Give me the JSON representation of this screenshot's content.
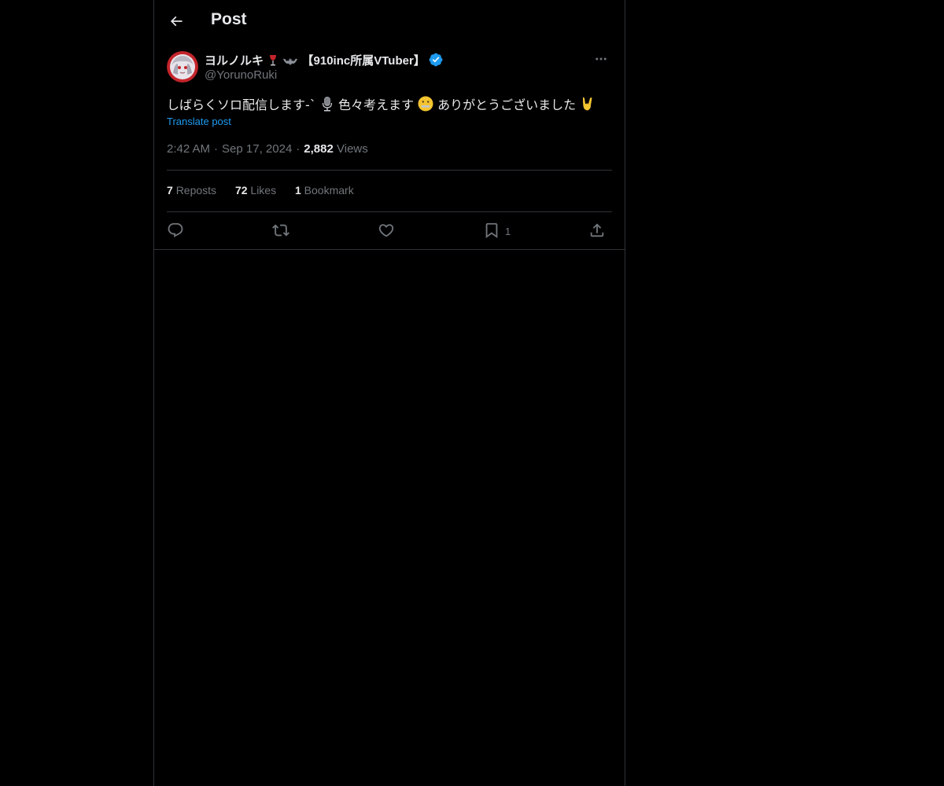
{
  "header": {
    "back_icon": "arrow-left-icon",
    "title": "Post"
  },
  "author": {
    "name": "ヨルノルキ",
    "name_suffix": "【910inc所属VTuber】",
    "name_emojis": [
      "wine-glass-icon",
      "bat-icon"
    ],
    "verified": true,
    "verified_color": "#1d9bf0",
    "handle": "@YorunoRuki",
    "more_icon": "more-horizontal-icon"
  },
  "post": {
    "text_part1": "しばらくソロ配信します-`",
    "text_part2": "色々考えます",
    "text_part3": "ありがとうございました",
    "inline_emojis": [
      "microphone-icon",
      "zipper-mouth-face-icon",
      "sign-of-horns-icon"
    ],
    "translate_label": "Translate post"
  },
  "meta": {
    "time": "2:42 AM",
    "date": "Sep 17, 2024",
    "views_count": "2,882",
    "views_label": "Views"
  },
  "stats": {
    "reposts_count": "7",
    "reposts_label": "Reposts",
    "likes_count": "72",
    "likes_label": "Likes",
    "bookmarks_count": "1",
    "bookmarks_label": "Bookmark"
  },
  "actions": {
    "reply_icon": "reply-icon",
    "repost_icon": "repost-icon",
    "like_icon": "heart-icon",
    "bookmark_icon": "bookmark-icon",
    "bookmark_count": "1",
    "share_icon": "share-icon"
  },
  "colors": {
    "background": "#000000",
    "text": "#e7e9ea",
    "muted": "#71767b",
    "border": "#2f3336",
    "link": "#1d9bf0"
  }
}
